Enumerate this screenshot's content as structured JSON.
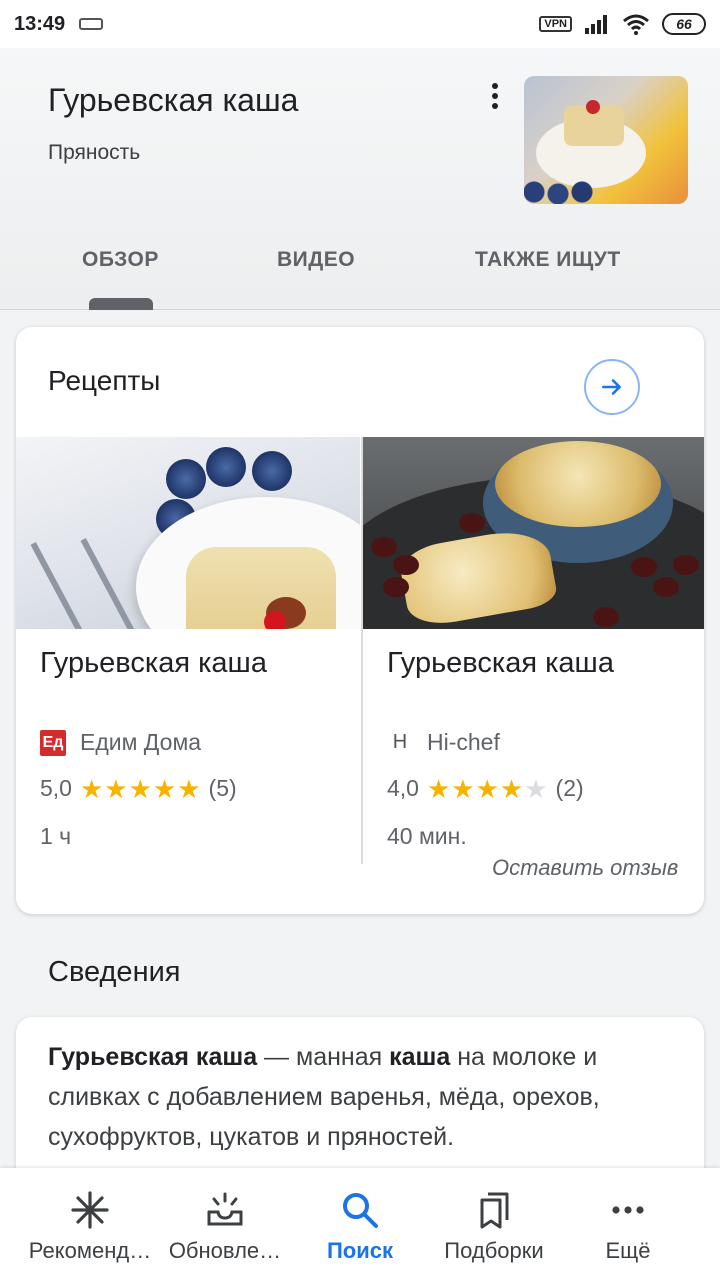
{
  "status": {
    "time": "13:49",
    "vpn": "VPN",
    "battery": "66"
  },
  "header": {
    "title": "Гурьевская каша",
    "subtitle": "Пряность",
    "more_icon": "more-vert-icon"
  },
  "tabs": [
    {
      "label": "ОБЗОР",
      "active": true
    },
    {
      "label": "ВИДЕО",
      "active": false
    },
    {
      "label": "ТАКЖЕ ИЩУТ",
      "active": false
    }
  ],
  "recipes": {
    "title": "Рецепты",
    "items": [
      {
        "name": "Гурьевская каша",
        "source": "Едим Дома",
        "source_logo": "Ед",
        "rating": "5,0",
        "stars": 5,
        "reviews": "(5)",
        "time": "1 ч"
      },
      {
        "name": "Гурьевская каша",
        "source": "Hi-chef",
        "source_logo": "H",
        "rating": "4,0",
        "stars": 4,
        "reviews": "(2)",
        "time": "40 мин."
      }
    ],
    "review_link": "Оставить отзыв"
  },
  "info": {
    "section_title": "Сведения",
    "bold1": "Гурьевская каша",
    "text1": " — манная ",
    "bold2": "каша",
    "text2": " на молоке и сливках с добавлением варенья, мёда, орехов, сухофруктов, цукатов и пряностей."
  },
  "bottom_nav": [
    {
      "label": "Рекоменд…",
      "icon": "asterisk-icon",
      "active": false
    },
    {
      "label": "Обновле…",
      "icon": "inbox-updates-icon",
      "active": false
    },
    {
      "label": "Поиск",
      "icon": "search-icon",
      "active": true
    },
    {
      "label": "Подборки",
      "icon": "collections-icon",
      "active": false
    },
    {
      "label": "Ещё",
      "icon": "more-horiz-icon",
      "active": false
    }
  ],
  "colors": {
    "accent": "#1a73e8",
    "star": "#f6b400",
    "star_off": "#dadce0"
  }
}
